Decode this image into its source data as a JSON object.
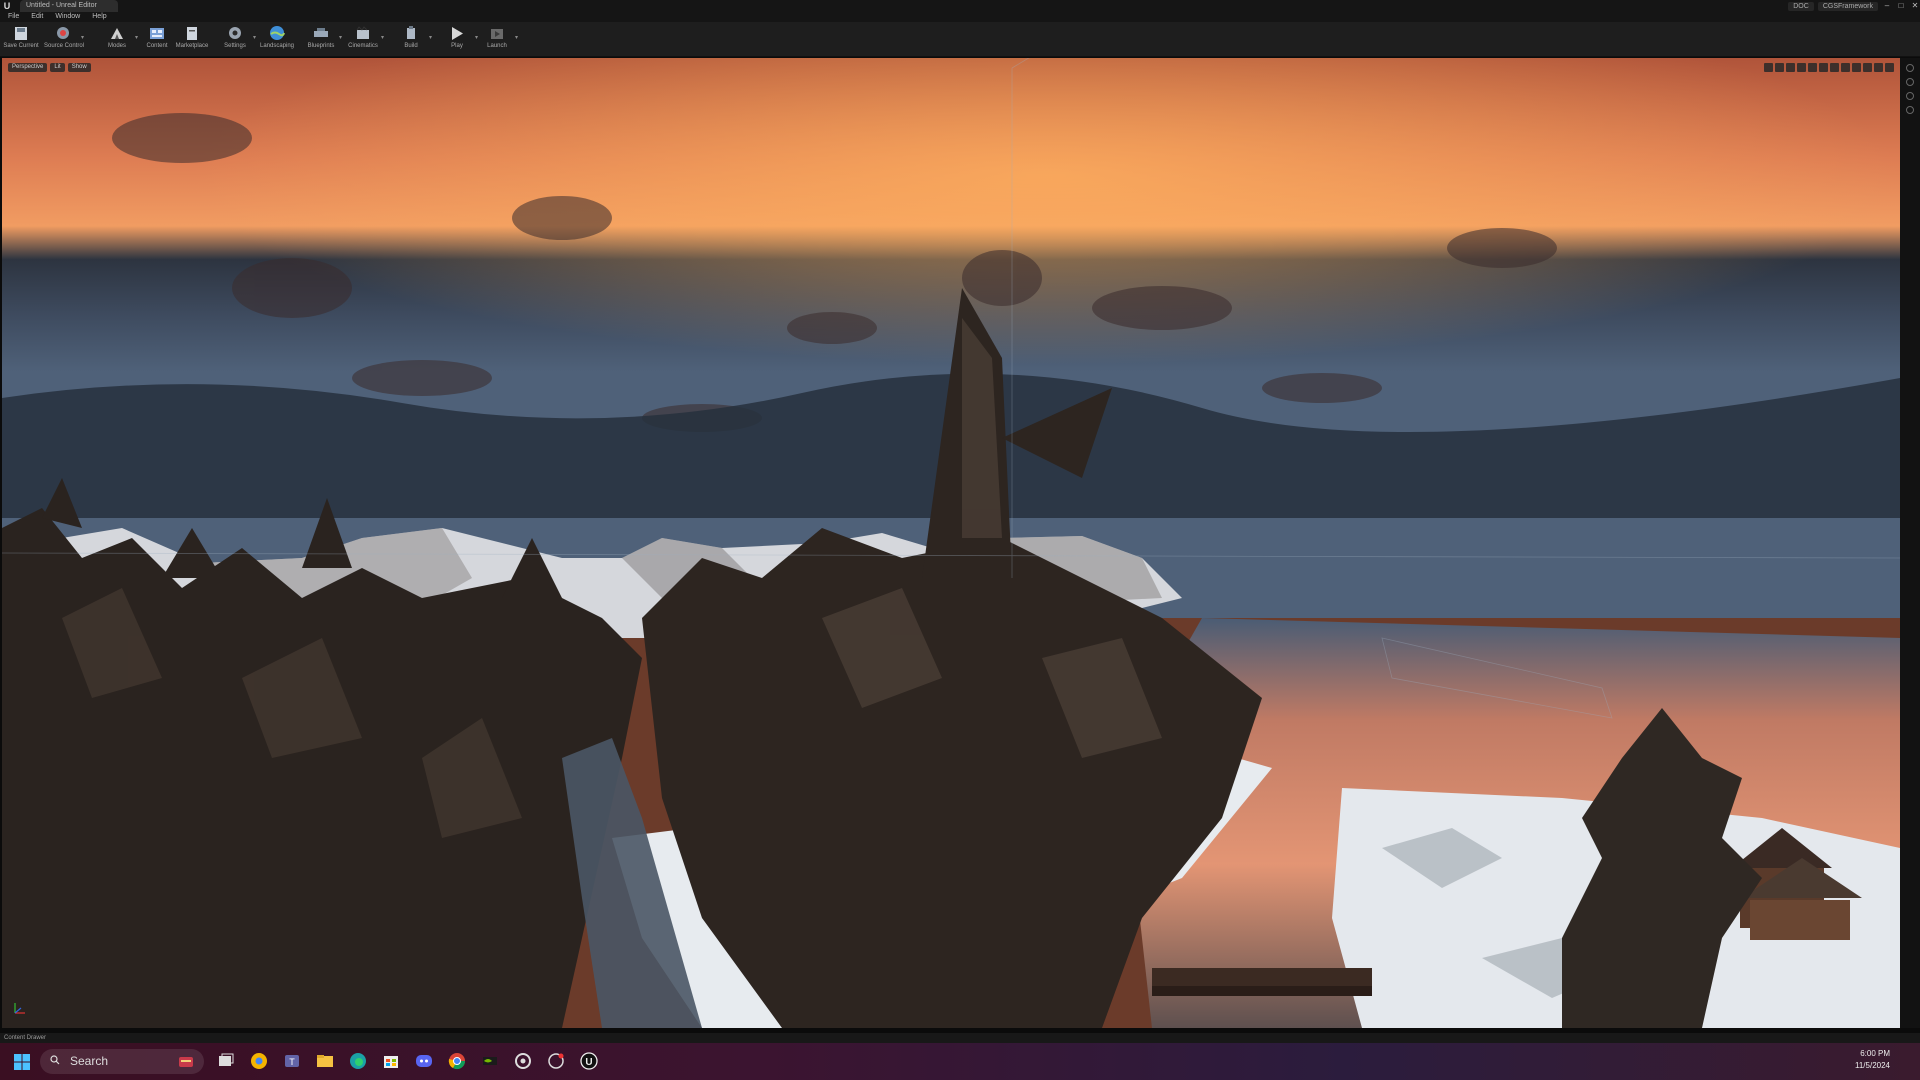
{
  "window": {
    "tab_title": "Untitled - Unreal Editor",
    "user_chip": "DOC",
    "project_chip": "CGSFramework",
    "controls": [
      "–",
      "□",
      "✕"
    ]
  },
  "menu": [
    "File",
    "Edit",
    "Window",
    "Help"
  ],
  "toolbar": {
    "tools": [
      {
        "label": "Save Current",
        "icon": "save-icon"
      },
      {
        "label": "Source Control",
        "icon": "source-control-icon"
      },
      {
        "label": "Modes",
        "icon": "modes-icon"
      },
      {
        "label": "Content",
        "icon": "content-icon"
      },
      {
        "label": "Marketplace",
        "icon": "marketplace-icon"
      },
      {
        "label": "Settings",
        "icon": "settings-icon"
      },
      {
        "label": "Landscaping",
        "icon": "landscaping-icon"
      },
      {
        "label": "Blueprints",
        "icon": "blueprints-icon"
      },
      {
        "label": "Cinematics",
        "icon": "cinematics-icon"
      },
      {
        "label": "Build",
        "icon": "build-icon"
      },
      {
        "label": "Play",
        "icon": "play-icon"
      },
      {
        "label": "Launch",
        "icon": "launch-icon"
      }
    ]
  },
  "viewport": {
    "buttons": [
      "Perspective",
      "Lit",
      "Show"
    ],
    "right_controls": 16
  },
  "statusbar": {
    "content_drawer": "Content Drawer"
  },
  "taskbar": {
    "search_placeholder": "Search",
    "time": "6:00 PM",
    "date": "11/5/2024",
    "apps": [
      "task-view-icon",
      "chrome-canary-icon",
      "teams-icon",
      "file-explorer-icon",
      "edge-icon",
      "store-icon",
      "discord-icon",
      "chrome-icon",
      "nvidia-icon",
      "settings-icon",
      "app-icon",
      "unreal-engine-icon"
    ]
  },
  "colors": {
    "accent": "#0078d4",
    "sky_glow": "#e98a5a",
    "water": "#d98a6e"
  }
}
